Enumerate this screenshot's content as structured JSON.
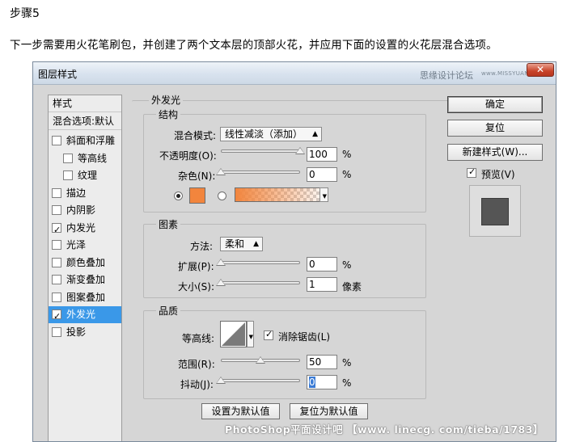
{
  "step": "步骤5",
  "intro": "下一步需要用火花笔刷包，并创建了两个文本层的顶部火花，并应用下面的设置的火花层混合选项。",
  "dialog": {
    "title": "图层样式",
    "watermark": "思缘设计论坛",
    "watermark_url": "www.MISSYUAN.COM",
    "close": "✕"
  },
  "style_list": {
    "header": "样式",
    "blend_default": "混合选项:默认",
    "items": [
      {
        "label": "斜面和浮雕",
        "checked": false
      },
      {
        "label": "等高线",
        "checked": false
      },
      {
        "label": "纹理",
        "checked": false
      },
      {
        "label": "描边",
        "checked": false
      },
      {
        "label": "内阴影",
        "checked": false
      },
      {
        "label": "内发光",
        "checked": true
      },
      {
        "label": "光泽",
        "checked": false
      },
      {
        "label": "颜色叠加",
        "checked": false
      },
      {
        "label": "渐变叠加",
        "checked": false
      },
      {
        "label": "图案叠加",
        "checked": false
      },
      {
        "label": "外发光",
        "checked": true
      },
      {
        "label": "投影",
        "checked": false
      }
    ]
  },
  "outer_glow": {
    "title": "外发光",
    "structure": {
      "title": "结构",
      "blend_mode_label": "混合模式:",
      "blend_mode_value": "线性减淡（添加）",
      "opacity_label": "不透明度(O):",
      "opacity_value": "100",
      "opacity_percent": 100,
      "noise_label": "杂色(N):",
      "noise_value": "0",
      "noise_percent": 0,
      "percent": "%"
    },
    "elements": {
      "title": "图素",
      "technique_label": "方法:",
      "technique_value": "柔和",
      "spread_label": "扩展(P):",
      "spread_value": "0",
      "spread_percent": 0,
      "size_label": "大小(S):",
      "size_value": "1",
      "size_percent": 0,
      "size_unit": "像素",
      "percent": "%"
    },
    "quality": {
      "title": "品质",
      "contour_label": "等高线:",
      "antialias_label": "消除锯齿(L)",
      "range_label": "范围(R):",
      "range_value": "50",
      "range_percent": 50,
      "jitter_label": "抖动(J):",
      "jitter_value": "0",
      "jitter_percent": 0,
      "percent": "%"
    },
    "make_default": "设置为默认值",
    "reset_default": "复位为默认值"
  },
  "buttons": {
    "ok": "确定",
    "reset": "复位",
    "new_style": "新建样式(W)...",
    "preview_label": "预览(V)"
  },
  "colors": {
    "glow_color": "#f2853d",
    "selection": "#3a98e8",
    "preview_swatch": "#555555"
  },
  "bottom_watermark": "PhotoShop平面设计吧 【www. linecg. com/tieba/1783】"
}
